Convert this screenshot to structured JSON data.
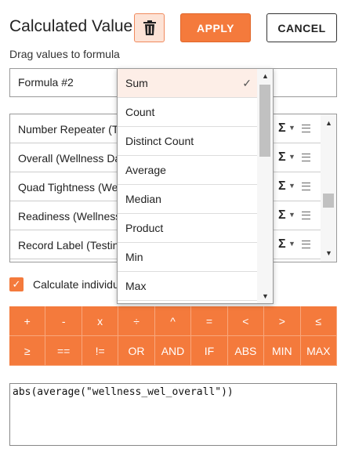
{
  "header": {
    "title": "Calculated Value",
    "delete_icon": "trash-icon",
    "apply_label": "APPLY",
    "cancel_label": "CANCEL"
  },
  "subtitle": "Drag values to formula",
  "formula_name": "Formula #2",
  "fields": [
    {
      "label": "Number Repeater (T",
      "aggregate_icon": "Σ"
    },
    {
      "label": "Overall (Wellness Da",
      "aggregate_icon": "Σ"
    },
    {
      "label": "Quad Tightness (We",
      "aggregate_icon": "Σ"
    },
    {
      "label": "Readiness (Wellness",
      "aggregate_icon": "Σ"
    },
    {
      "label": "Record Label (Testin",
      "aggregate_icon": "Σ"
    }
  ],
  "calculate_individually": {
    "label": "Calculate individu",
    "checked": true
  },
  "keypad": {
    "row1": [
      "+",
      "-",
      "x",
      "÷",
      "^",
      "=",
      "<",
      ">",
      "≤"
    ],
    "row2": [
      "≥",
      "==",
      "!=",
      "OR",
      "AND",
      "IF",
      "ABS",
      "MIN",
      "MAX"
    ]
  },
  "expression": "abs(average(\"wellness_wel_overall\"))",
  "aggregate_dropdown": {
    "options": [
      "Sum",
      "Count",
      "Distinct Count",
      "Average",
      "Median",
      "Product",
      "Min",
      "Max"
    ],
    "selected": "Sum",
    "check_icon": "checkmark-icon"
  },
  "colors": {
    "accent": "#f47a3c",
    "accent_light": "#fde3d6",
    "selected_bg": "#fdeee7"
  }
}
